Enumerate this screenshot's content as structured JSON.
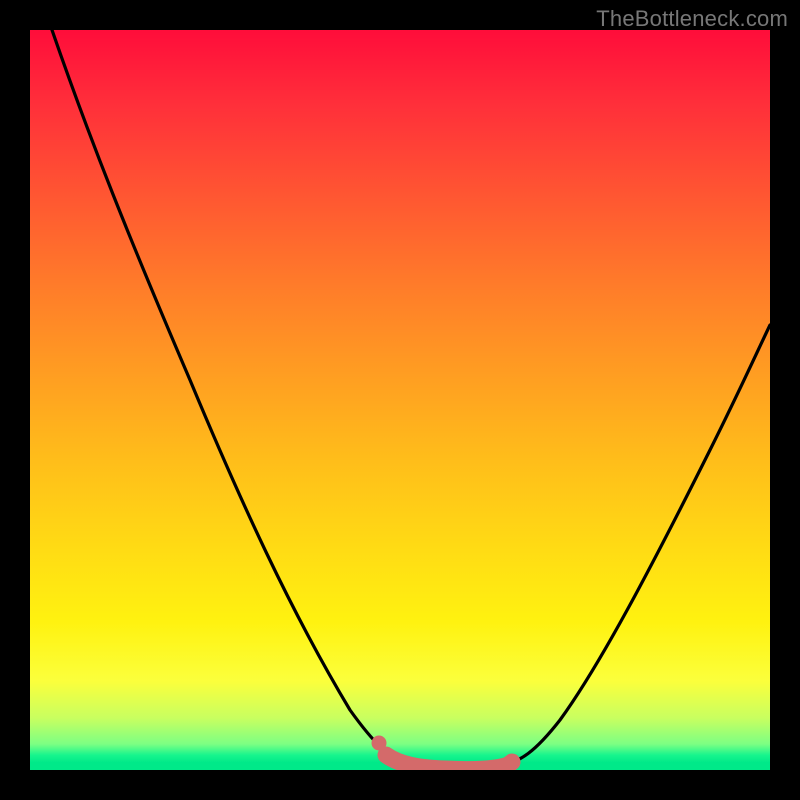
{
  "watermark": "TheBottleneck.com",
  "colors": {
    "frame": "#000000",
    "gradient_top": "#ff0d3a",
    "gradient_mid1": "#ff9c22",
    "gradient_mid2": "#fff210",
    "gradient_bottom": "#00e989",
    "curve_stroke": "#000000",
    "dot_fill": "#d46a6a",
    "dot_stroke": "#d46a6a"
  },
  "chart_data": {
    "type": "line",
    "title": "",
    "xlabel": "",
    "ylabel": "",
    "xlim": [
      0,
      100
    ],
    "ylim": [
      0,
      100
    ],
    "grid": false,
    "legend": false,
    "series": [
      {
        "name": "bottleneck-curve",
        "x": [
          3,
          8,
          14,
          22,
          30,
          38,
          44,
          48,
          51,
          53.5,
          56,
          60,
          63,
          66,
          70,
          75,
          82,
          90,
          97
        ],
        "y": [
          100,
          85,
          70,
          52,
          35,
          20,
          10,
          4,
          1,
          0,
          0,
          0.5,
          2,
          4,
          9,
          17,
          30,
          46,
          60
        ]
      }
    ],
    "markers": {
      "name": "highlight-bar",
      "x": [
        48,
        50,
        52,
        54,
        56,
        58,
        60,
        62,
        64
      ],
      "y": [
        2.0,
        0.8,
        0.3,
        0.1,
        0.1,
        0.3,
        0.7,
        1.3,
        2.2
      ],
      "single_dot": {
        "x": 47,
        "y": 3.5
      }
    }
  }
}
